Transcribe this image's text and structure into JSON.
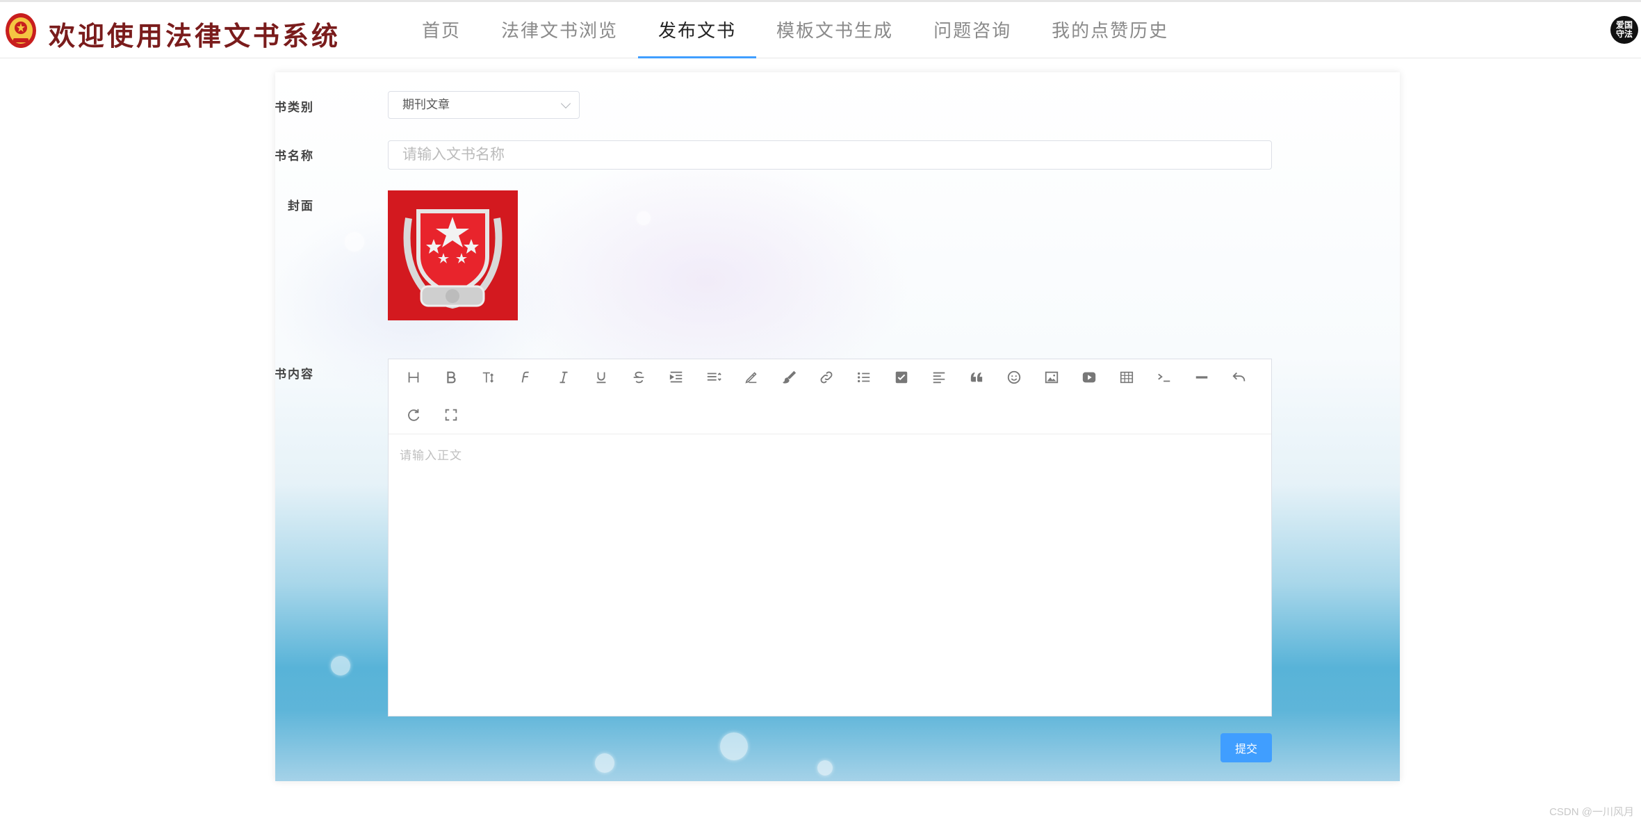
{
  "header": {
    "title": "欢迎使用法律文书系统",
    "nav": [
      {
        "label": "首页",
        "active": false
      },
      {
        "label": "法律文书浏览",
        "active": false
      },
      {
        "label": "发布文书",
        "active": true
      },
      {
        "label": "模板文书生成",
        "active": false
      },
      {
        "label": "问题咨询",
        "active": false
      },
      {
        "label": "我的点赞历史",
        "active": false
      }
    ],
    "user_badge": "爱国守法"
  },
  "form": {
    "category_label": "文书类别",
    "category_value": "期刊文章",
    "name_label": "文书名称",
    "name_placeholder": "请输入文书名称",
    "name_value": "",
    "cover_label": "封面",
    "content_label": "文书内容",
    "content_placeholder": "请输入正文",
    "submit_label": "提交"
  },
  "editor_toolbar": [
    "heading-icon",
    "bold-icon",
    "font-size-icon",
    "font-family-icon",
    "italic-icon",
    "underline-icon",
    "strikethrough-icon",
    "indent-icon",
    "line-height-icon",
    "text-color-icon",
    "background-color-icon",
    "link-icon",
    "bulleted-list-icon",
    "todo-icon",
    "align-left-icon",
    "quote-icon",
    "emoji-icon",
    "image-icon",
    "video-icon",
    "table-icon",
    "code-icon",
    "divider-icon",
    "undo-icon",
    "redo-icon",
    "fullscreen-icon"
  ],
  "colors": {
    "accent": "#409eff",
    "title": "#7a1c1c",
    "cover_red": "#d3191f"
  },
  "watermark": "CSDN @一川风月"
}
